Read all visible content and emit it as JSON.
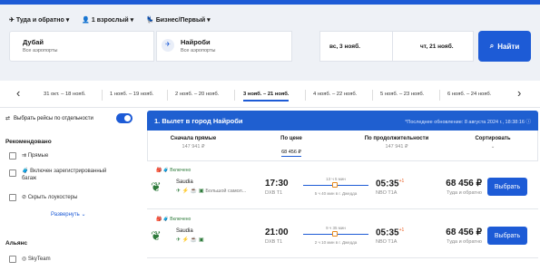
{
  "search": {
    "trip_type": "Туда и обратно",
    "passengers": "1 взрослый",
    "class": "Бизнес/Первый",
    "from_city": "Дубай",
    "from_sub": "Все аэропорты",
    "to_city": "Найроби",
    "to_sub": "Все аэропорты",
    "depart_date": "вс, 3 нояб.",
    "return_date": "чт, 21 нояб.",
    "find_label": "Найти"
  },
  "dates": [
    "31 окт. – 18 нояб.",
    "1 нояб. – 19 нояб.",
    "2 нояб. – 20 нояб.",
    "3 нояб. – 21 нояб.",
    "4 нояб. – 22 нояб.",
    "5 нояб. – 23 нояб.",
    "6 нояб. – 24 нояб."
  ],
  "sidebar": {
    "toggle_label": "Выбрать рейсы по отдельности",
    "recommended_title": "Рекомендовано",
    "filters": [
      "Прямые",
      "Включен зарегистрированный багаж",
      "Скрыть лоукостеры"
    ],
    "expand_label": "Развернуть",
    "alliance_title": "Альянс",
    "alliance_item": "SkyTeam"
  },
  "results": {
    "title": "1. Вылет в город Найроби",
    "updated": "*Последнее обновление: 8 августа 2024 г., 18:38:16",
    "sort": [
      {
        "label": "Сначала прямые",
        "price": "147 941 ₽"
      },
      {
        "label": "По цене",
        "price": "68 456 ₽"
      },
      {
        "label": "По продолжительности",
        "price": "147 941 ₽"
      },
      {
        "label": "Сортировать",
        "price": ""
      }
    ],
    "flights": [
      {
        "incl": "Включено",
        "airline": "Saudia",
        "amen": "Большой самол...",
        "dep": "17:30",
        "dep_ap": "DXB T1",
        "dur": "13 ч 5 мин",
        "stop": "5 ч 40 мин в г. Джедда",
        "arr": "05:35",
        "plus": "+1",
        "arr_ap": "NBO T1A",
        "price": "68 456 ₽",
        "ptype": "Туда и обратно",
        "buy": "Выбрать"
      },
      {
        "incl": "Включено",
        "airline": "Saudia",
        "amen": "",
        "dep": "21:00",
        "dep_ap": "DXB T1",
        "dur": "9 ч 35 мин",
        "stop": "2 ч 10 мин в г. Джедда",
        "arr": "05:35",
        "plus": "+1",
        "arr_ap": "NBO T1A",
        "price": "68 456 ₽",
        "ptype": "Туда и обратно",
        "buy": "Выбрать"
      }
    ]
  },
  "colors": {
    "accent": "#1d5bd6",
    "header": "#1f5fd0"
  }
}
